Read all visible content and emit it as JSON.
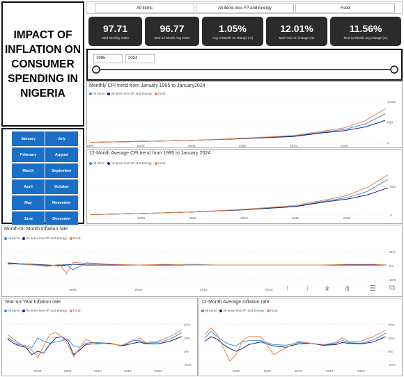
{
  "header": {
    "title": "IMPACT OF INFLATION ON CONSUMER SPENDING IN NIGERIA"
  },
  "filters": [
    "All items",
    "All items less FP and Energy",
    "Food"
  ],
  "kpis": [
    {
      "value": "97.71",
      "label": "Med Monthly Index"
    },
    {
      "value": "96.77",
      "label": "Med 12-Month Avg Index"
    },
    {
      "value": "1.05%",
      "label": "Avg of Month-on change (%)"
    },
    {
      "value": "12.01%",
      "label": "Med Year-on change (%)"
    },
    {
      "value": "11.56%",
      "label": "Med 12-Month avg change (%)"
    }
  ],
  "slider": {
    "start": "1995",
    "end": "2024"
  },
  "months": [
    "January",
    "July",
    "February",
    "August",
    "March",
    "September",
    "April",
    "October",
    "May",
    "November",
    "June",
    "December"
  ],
  "legend": [
    "All items",
    "All items less FP and Energy",
    "Food"
  ],
  "colors": {
    "all_items": "#3d8fe0",
    "core": "#1a237e",
    "food": "#e8834e",
    "button": "#1b6fc6",
    "card": "#2b2b2b"
  },
  "toolbar_icons": [
    "arrow-up-icon",
    "arrow-down-icon",
    "double-arrow-down-icon",
    "expand-hierarchy-icon",
    "filter-icon",
    "focus-mode-icon"
  ],
  "chart_data": [
    {
      "type": "line",
      "title": "Monthly CPI trend from January 1995 to January2024",
      "x": [
        1995,
        2000,
        2005,
        2010,
        2015,
        2018,
        2020,
        2022,
        2024
      ],
      "x_ticks": [
        "1995",
        "2000",
        "2005",
        "2010",
        "2015",
        "2020"
      ],
      "y_ticks": [
        "1,000",
        "500",
        "0"
      ],
      "ylim": [
        0,
        1000
      ],
      "series": [
        {
          "name": "All items",
          "values": [
            7,
            28,
            55,
            100,
            160,
            260,
            320,
            450,
            700
          ]
        },
        {
          "name": "All items less FP and Energy",
          "values": [
            7,
            28,
            55,
            95,
            150,
            240,
            290,
            380,
            540
          ]
        },
        {
          "name": "Food",
          "values": [
            7,
            27,
            55,
            105,
            175,
            285,
            360,
            530,
            820
          ]
        }
      ]
    },
    {
      "type": "line",
      "title": "12-Month Average CPI trend from 1995 to January 2024",
      "x": [
        1995,
        2000,
        2005,
        2010,
        2015,
        2018,
        2020,
        2022,
        2024
      ],
      "x_ticks": [
        "2000",
        "2005",
        "2010",
        "2015",
        "2020"
      ],
      "y_ticks": [
        "500",
        "0"
      ],
      "ylim": [
        0,
        800
      ],
      "series": [
        {
          "name": "All items",
          "values": [
            6,
            26,
            52,
            95,
            152,
            245,
            300,
            410,
            620
          ]
        },
        {
          "name": "All items less FP and Energy",
          "values": [
            6,
            26,
            52,
            90,
            145,
            230,
            275,
            350,
            470
          ]
        },
        {
          "name": "Food",
          "values": [
            6,
            25,
            52,
            98,
            165,
            265,
            340,
            480,
            700
          ]
        }
      ]
    },
    {
      "type": "line",
      "title": "Month-on Month Inflation rate",
      "x": [
        1995,
        1996,
        1997,
        1998,
        1999,
        1999.5,
        2000,
        2001,
        2003,
        2005,
        2007,
        2009,
        2011,
        2013,
        2015,
        2017,
        2019,
        2021,
        2023,
        2024
      ],
      "x_ticks": [
        "2000",
        "2005",
        "2010",
        "2015"
      ],
      "y_ticks": [
        "20%",
        "0%",
        "-20%"
      ],
      "ylim": [
        -30,
        30
      ],
      "series": [
        {
          "name": "All items",
          "values": [
            3,
            2,
            1,
            0,
            1,
            2,
            -6,
            4,
            2,
            1,
            1,
            2,
            1,
            1,
            1,
            1,
            1,
            1,
            2,
            1
          ]
        },
        {
          "name": "All items less FP and Energy",
          "values": [
            4,
            3,
            2,
            1,
            0,
            1,
            2,
            1,
            1,
            1,
            1,
            1,
            1,
            1,
            1,
            1,
            1,
            1,
            1,
            1
          ]
        },
        {
          "name": "Food",
          "values": [
            2,
            3,
            1,
            -1,
            2,
            -12,
            5,
            3,
            2,
            1,
            2,
            1,
            1,
            1,
            1,
            1,
            1,
            2,
            2,
            1
          ]
        }
      ]
    },
    {
      "type": "line",
      "title": "Year-on-Year Inflation rate",
      "x": [
        1995,
        1996,
        1997,
        1998,
        1999,
        2000,
        2001,
        2002,
        2003,
        2004,
        2005,
        2006,
        2007,
        2008,
        2009,
        2010,
        2012,
        2014,
        2016,
        2017,
        2018,
        2020,
        2022,
        2024
      ],
      "x_ticks": [
        "2000",
        "2005",
        "2010",
        "2015",
        "2020"
      ],
      "y_ticks": [
        "40%",
        "20%",
        "0%",
        "-20%"
      ],
      "ylim": [
        -25,
        50
      ],
      "series": [
        {
          "name": "All items",
          "values": [
            20,
            15,
            10,
            8,
            5,
            20,
            15,
            12,
            14,
            16,
            18,
            8,
            6,
            12,
            13,
            13,
            12,
            8,
            16,
            16,
            12,
            13,
            18,
            28
          ]
        },
        {
          "name": "All items less FP and Energy",
          "values": [
            18,
            12,
            8,
            6,
            -5,
            0,
            -3,
            10,
            20,
            22,
            15,
            -5,
            2,
            10,
            11,
            11,
            12,
            8,
            12,
            14,
            11,
            11,
            15,
            22
          ]
        },
        {
          "name": "Food",
          "values": [
            25,
            18,
            12,
            6,
            2,
            -10,
            8,
            25,
            28,
            22,
            10,
            -8,
            5,
            18,
            14,
            12,
            11,
            9,
            17,
            20,
            13,
            15,
            22,
            32
          ]
        }
      ]
    },
    {
      "type": "line",
      "title": "12-Month Average Inflation rate",
      "x": [
        1995,
        1996,
        1997,
        1998,
        1999,
        2000,
        2001,
        2002,
        2004,
        2006,
        2008,
        2010,
        2012,
        2014,
        2016,
        2017,
        2018,
        2020,
        2022,
        2024
      ],
      "x_ticks": [
        "2000",
        "2005",
        "2010",
        "2015",
        "2020"
      ],
      "y_ticks": [
        "40%",
        "20%",
        "0%",
        "-20%"
      ],
      "ylim": [
        -25,
        50
      ],
      "series": [
        {
          "name": "All items",
          "values": [
            20,
            30,
            22,
            15,
            10,
            8,
            14,
            16,
            16,
            10,
            9,
            13,
            12,
            9,
            12,
            16,
            13,
            12,
            17,
            27
          ]
        },
        {
          "name": "All items less FP and Energy",
          "values": [
            15,
            22,
            18,
            10,
            4,
            0,
            4,
            10,
            14,
            8,
            6,
            11,
            12,
            9,
            10,
            13,
            12,
            11,
            14,
            22
          ]
        },
        {
          "name": "Food",
          "values": [
            25,
            35,
            25,
            5,
            -15,
            -5,
            15,
            22,
            22,
            -5,
            5,
            15,
            12,
            10,
            13,
            20,
            15,
            15,
            22,
            32
          ]
        }
      ]
    }
  ]
}
